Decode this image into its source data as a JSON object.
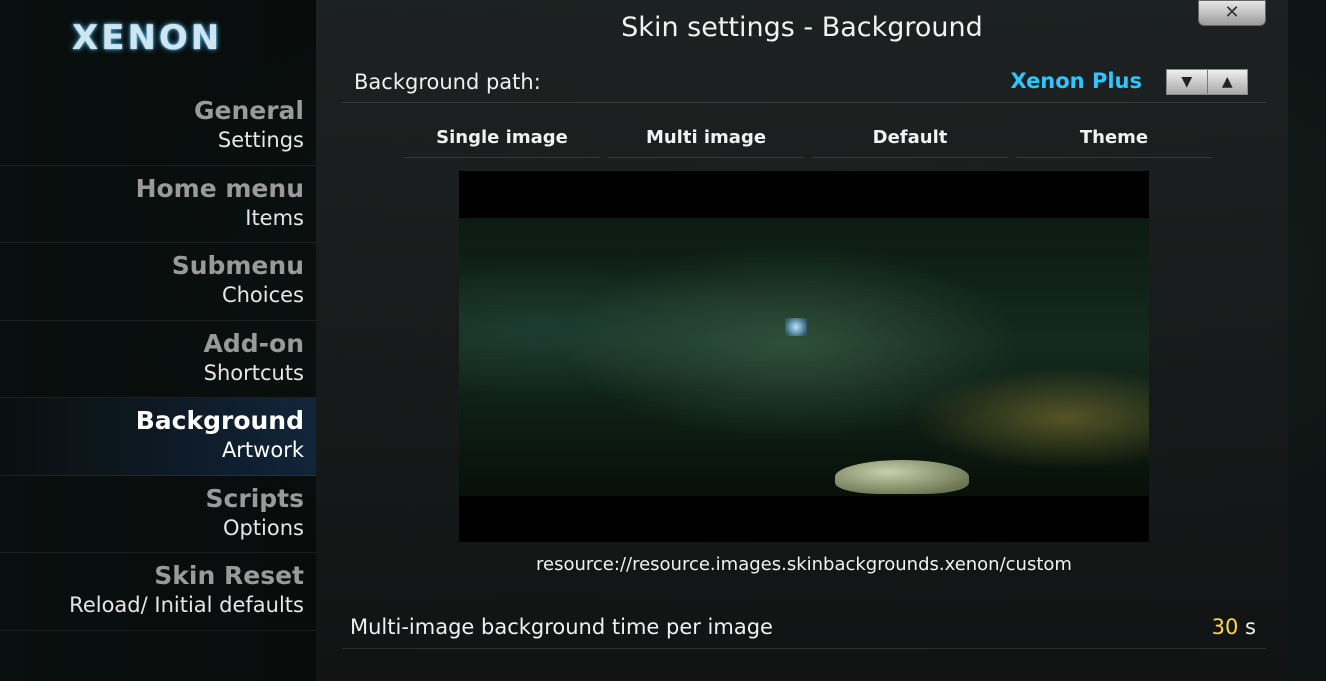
{
  "app": {
    "logo_text": "XENON"
  },
  "sidebar": {
    "items": [
      {
        "title": "General",
        "subtitle": "Settings",
        "active": false
      },
      {
        "title": "Home menu",
        "subtitle": "Items",
        "active": false
      },
      {
        "title": "Submenu",
        "subtitle": "Choices",
        "active": false
      },
      {
        "title": "Add-on",
        "subtitle": "Shortcuts",
        "active": false
      },
      {
        "title": "Background",
        "subtitle": "Artwork",
        "active": true
      },
      {
        "title": "Scripts",
        "subtitle": "Options",
        "active": false
      },
      {
        "title": "Skin Reset",
        "subtitle": "Reload/ Initial defaults",
        "active": false
      }
    ]
  },
  "dialog": {
    "title": "Skin settings - Background",
    "close_label": "✕",
    "background_path": {
      "label": "Background path:",
      "value": "Xenon Plus",
      "spinner_down": "▼",
      "spinner_up": "▲"
    },
    "tabs": [
      "Single image",
      "Multi image",
      "Default",
      "Theme"
    ],
    "preview_caption": "resource://resource.images.skinbackgrounds.xenon/custom",
    "multi_time": {
      "label": "Multi-image background time per image",
      "value": "30",
      "unit": "s"
    }
  },
  "colors": {
    "accent_value": "#2ec6ff",
    "number_value": "#ffd54a"
  }
}
